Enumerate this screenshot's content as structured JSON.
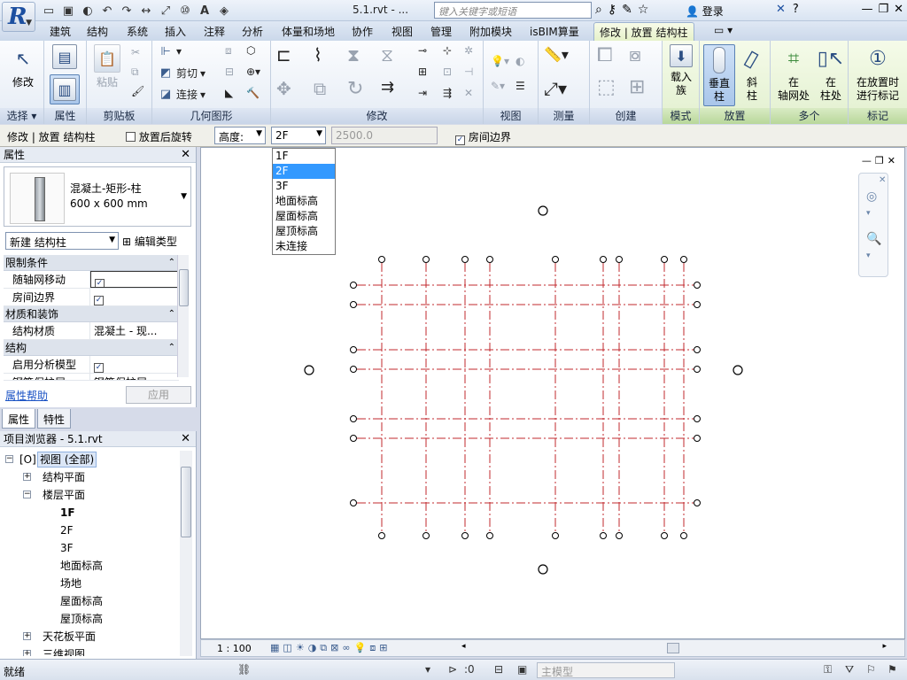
{
  "title_bar": {
    "title": "5.1.rvt - ...",
    "search_placeholder": "键入关键字或短语",
    "login": "登录"
  },
  "tabs": [
    "建筑",
    "结构",
    "系统",
    "插入",
    "注释",
    "分析",
    "体量和场地",
    "协作",
    "视图",
    "管理",
    "附加模块",
    "isBIM算量",
    "修改 | 放置 结构柱"
  ],
  "ribbon": {
    "select": {
      "modify": "修改",
      "label": "选择 ▾"
    },
    "properties": {
      "label": "属性"
    },
    "clipboard": {
      "paste": "粘贴",
      "label": "剪贴板"
    },
    "geometry": {
      "cut": "剪切",
      "join": "连接",
      "label": "几何图形"
    },
    "modify": {
      "label": "修改"
    },
    "view": {
      "label": "视图"
    },
    "measure": {
      "label": "测量"
    },
    "create": {
      "label": "创建"
    },
    "mode": {
      "load_family_1": "载入",
      "load_family_2": "族",
      "label": "模式"
    },
    "placement": {
      "vertical_1": "垂直",
      "vertical_2": "柱",
      "slanted_1": "斜",
      "slanted_2": "柱",
      "label": "放置"
    },
    "multiple": {
      "at_grids_1": "在",
      "at_grids_2": "轴网处",
      "at_columns_1": "在",
      "at_columns_2": "柱处",
      "label": "多个"
    },
    "tag": {
      "tag_1": "在放置时",
      "tag_2": "进行标记",
      "label": "标记"
    }
  },
  "options_bar": {
    "context": "修改 | 放置 结构柱",
    "rotate_after": "放置后旋转",
    "height_label": "高度:",
    "level_value": "2F",
    "offset_value": "2500.0",
    "room_bounding": "房间边界"
  },
  "level_dropdown": [
    "1F",
    "2F",
    "3F",
    "地面标高",
    "屋面标高",
    "屋顶标高",
    "未连接"
  ],
  "level_dropdown_selected": 1,
  "properties": {
    "header": "属性",
    "type_name_1": "混凝土-矩形-柱",
    "type_name_2": "600 x 600 mm",
    "instance_filter": "新建 结构柱",
    "edit_type": "编辑类型",
    "groups": {
      "constraints": "限制条件",
      "materials": "材质和装饰",
      "structural": "结构"
    },
    "rows": {
      "move_with_grids": "随轴网移动",
      "room_bounding": "房间边界",
      "struct_material": "结构材质",
      "struct_material_value": "混凝土 - 现...",
      "enable_analytical": "启用分析模型",
      "partial_row": "钢筋保护层...",
      "partial_value": "钢筋保护层..."
    },
    "help": "属性帮助",
    "apply": "应用",
    "tab_properties": "属性",
    "tab_characteristics": "特性"
  },
  "browser": {
    "header": "项目浏览器 - 5.1.rvt",
    "nodes": {
      "views": "视图 (全部)",
      "struct_plans": "结构平面",
      "floor_plans": "楼层平面",
      "f1": "1F",
      "f2": "2F",
      "f3": "3F",
      "ground": "地面标高",
      "site": "场地",
      "roof_level": "屋面标高",
      "top_level": "屋顶标高",
      "ceiling": "天花板平面",
      "three_d": "三维视图"
    }
  },
  "view_bar": {
    "scale": "1 : 100"
  },
  "status": {
    "text": "就绪",
    "count": ":0",
    "model": "主模型"
  },
  "colors": {
    "grid_line": "#c0282d",
    "accent_tab": "#e6f1c9",
    "selection": "#3399ff"
  }
}
